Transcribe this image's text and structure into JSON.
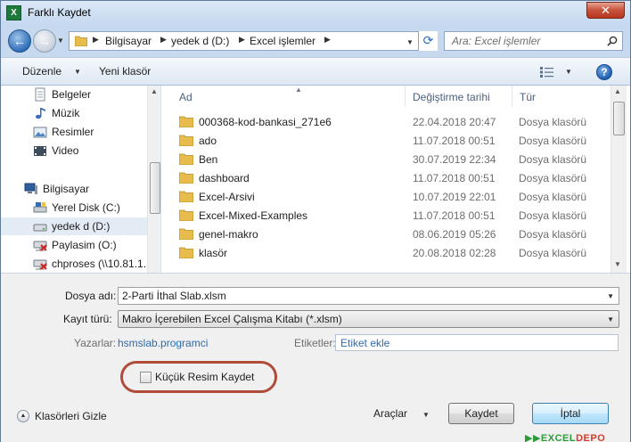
{
  "window": {
    "title": "Farklı Kaydet",
    "close_glyph": "✕"
  },
  "address": {
    "crumbs": [
      "Bilgisayar",
      "yedek d (D:)",
      "Excel işlemler"
    ],
    "search_placeholder": "Ara: Excel işlemler"
  },
  "toolbar": {
    "organize": "Düzenle",
    "new_folder": "Yeni klasör",
    "help": "?"
  },
  "nav": {
    "items": [
      {
        "label": "Belgeler",
        "icon": "documents-icon"
      },
      {
        "label": "Müzik",
        "icon": "music-icon"
      },
      {
        "label": "Resimler",
        "icon": "pictures-icon"
      },
      {
        "label": "Video",
        "icon": "video-icon"
      },
      {
        "label": "Bilgisayar",
        "icon": "computer-icon"
      },
      {
        "label": "Yerel Disk (C:)",
        "icon": "local-disk-icon"
      },
      {
        "label": "yedek d (D:)",
        "icon": "drive-icon"
      },
      {
        "label": "Paylasim (O:)",
        "icon": "network-drive-icon"
      },
      {
        "label": "chproses (\\\\10.81.1.1",
        "icon": "network-drive-icon"
      }
    ]
  },
  "files": {
    "columns": {
      "name": "Ad",
      "date": "Değiştirme tarihi",
      "type": "Tür"
    },
    "rows": [
      {
        "name": "000368-kod-bankasi_271e6",
        "date": "22.04.2018 20:47",
        "type": "Dosya klasörü"
      },
      {
        "name": "ado",
        "date": "11.07.2018 00:51",
        "type": "Dosya klasörü"
      },
      {
        "name": "Ben",
        "date": "30.07.2019 22:34",
        "type": "Dosya klasörü"
      },
      {
        "name": "dashboard",
        "date": "11.07.2018 00:51",
        "type": "Dosya klasörü"
      },
      {
        "name": "Excel-Arsivi",
        "date": "10.07.2019 22:01",
        "type": "Dosya klasörü"
      },
      {
        "name": "Excel-Mixed-Examples",
        "date": "11.07.2018 00:51",
        "type": "Dosya klasörü"
      },
      {
        "name": "genel-makro",
        "date": "08.06.2019 05:26",
        "type": "Dosya klasörü"
      },
      {
        "name": "klasör",
        "date": "20.08.2018 02:28",
        "type": "Dosya klasörü"
      }
    ]
  },
  "form": {
    "filename_label": "Dosya adı:",
    "filename_value": "2-Parti İthal Slab.xlsm",
    "type_label": "Kayıt türü:",
    "type_value": "Makro İçerebilen Excel Çalışma Kitabı (*.xlsm)",
    "authors_label": "Yazarlar:",
    "authors_value": "hsmslab.programci",
    "tags_label": "Etiketler:",
    "tags_value": "Etiket ekle",
    "thumbnail_label": "Küçük Resim Kaydet",
    "thumbnail_checked": false
  },
  "footer": {
    "hide_folders": "Klasörleri Gizle",
    "tools": "Araçlar",
    "save": "Kaydet",
    "cancel": "İptal"
  },
  "watermark": {
    "prefix": "▶▶",
    "brand_a": "EXCEL",
    "brand_b": "DEPO"
  }
}
